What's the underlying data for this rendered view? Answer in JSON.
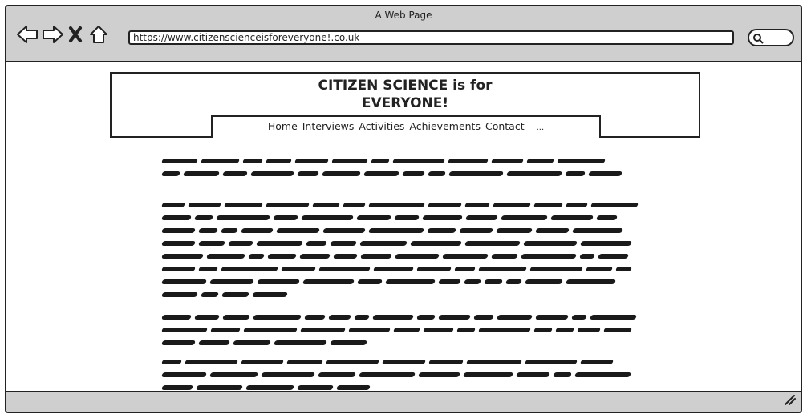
{
  "window": {
    "title": "A Web Page"
  },
  "toolbar": {
    "address_url": "https://www.citizenscienceisforeveryone!.co.uk"
  },
  "site": {
    "title_line1": "CITIZEN SCIENCE is for",
    "title_line2": "EVERYONE!",
    "nav": {
      "items": [
        {
          "label": "Home"
        },
        {
          "label": "Interviews"
        },
        {
          "label": "Activities"
        },
        {
          "label": "Achievements"
        },
        {
          "label": "Contact"
        }
      ],
      "more_label": "..."
    }
  },
  "icons": {
    "back": "back-arrow-icon",
    "forward": "forward-arrow-icon",
    "stop": "stop-icon",
    "home": "home-icon",
    "search": "search-icon",
    "resize": "resize-grip-icon"
  },
  "paragraphs": [
    {
      "lines": 2
    },
    {
      "lines": 8
    },
    {
      "lines": 3
    },
    {
      "lines": 3
    }
  ]
}
